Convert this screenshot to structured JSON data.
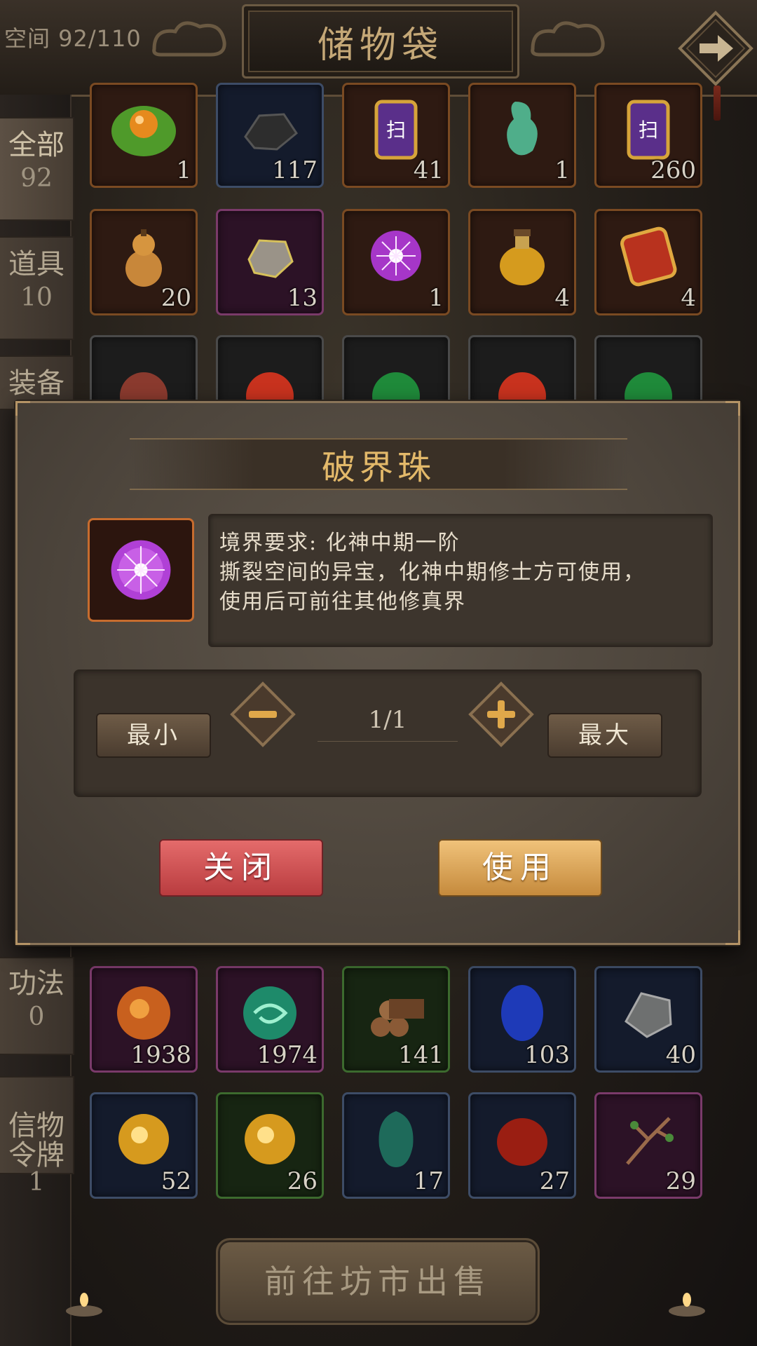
{
  "header": {
    "capacity": "空间 92/110",
    "title": "储物袋"
  },
  "sidebar": {
    "tabs": [
      {
        "label": "全部",
        "count": "92"
      },
      {
        "label": "道具",
        "count": "10"
      },
      {
        "label": "装备",
        "count": ""
      },
      {
        "label": "功法",
        "count": "0"
      },
      {
        "label": "信物\n令牌",
        "count": "1"
      }
    ]
  },
  "grid_top": [
    {
      "qty": "1",
      "icon": "lotus-pearl-icon"
    },
    {
      "qty": "117",
      "icon": "black-ore-icon"
    },
    {
      "qty": "41",
      "icon": "sweep-talisman-icon"
    },
    {
      "qty": "1",
      "icon": "jade-carving-icon"
    },
    {
      "qty": "260",
      "icon": "sweep-talisman-icon"
    },
    {
      "qty": "20",
      "icon": "gourd-icon"
    },
    {
      "qty": "13",
      "icon": "rune-stone-icon"
    },
    {
      "qty": "1",
      "icon": "purple-orb-icon"
    },
    {
      "qty": "4",
      "icon": "elixir-bottle-icon"
    },
    {
      "qty": "4",
      "icon": "command-token-icon"
    }
  ],
  "grid_bottom": [
    {
      "qty": "1938",
      "icon": "fire-orb-icon"
    },
    {
      "qty": "1974",
      "icon": "wind-orb-icon"
    },
    {
      "qty": "141",
      "icon": "wood-logs-icon"
    },
    {
      "qty": "103",
      "icon": "blue-crystal-icon"
    },
    {
      "qty": "40",
      "icon": "iron-ore-icon"
    },
    {
      "qty": "52",
      "icon": "gold-orb-icon"
    },
    {
      "qty": "26",
      "icon": "gold-orb-icon"
    },
    {
      "qty": "17",
      "icon": "green-gem-icon"
    },
    {
      "qty": "27",
      "icon": "red-gem-icon"
    },
    {
      "qty": "29",
      "icon": "herb-branch-icon"
    }
  ],
  "dialog": {
    "title": "破界珠",
    "desc_line1": "境界要求: 化神中期一阶",
    "desc_line2": "撕裂空间的异宝，化神中期修士方可使用，",
    "desc_line3": "使用后可前往其他修真界",
    "min_label": "最小",
    "max_label": "最大",
    "quantity": "1/1",
    "close_label": "关闭",
    "use_label": "使用"
  },
  "footer": {
    "sell_label": "前往坊市出售"
  },
  "colors": {
    "accent_gold": "#e3b96a",
    "close_red": "#c94a4d",
    "use_gold": "#d9a458"
  }
}
